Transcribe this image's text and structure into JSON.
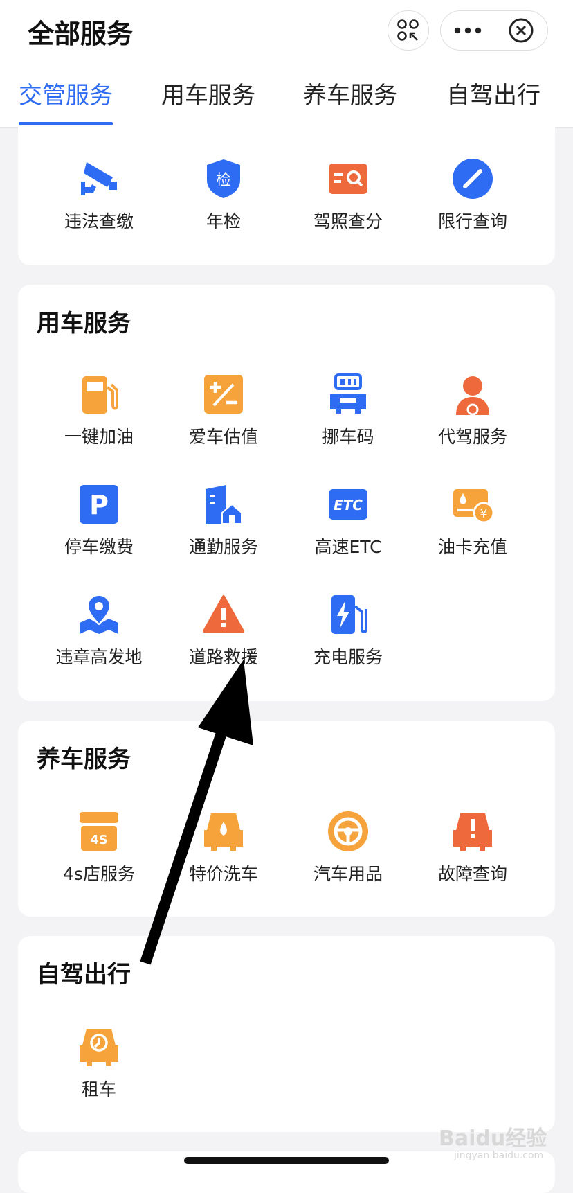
{
  "header": {
    "title": "全部服务",
    "tabs": [
      {
        "label": "交管服务",
        "active": true
      },
      {
        "label": "用车服务",
        "active": false
      },
      {
        "label": "养车服务",
        "active": false
      },
      {
        "label": "自驾出行",
        "active": false
      }
    ]
  },
  "sections": {
    "traffic": {
      "items": [
        {
          "label": "违法查缴",
          "icon": "camera-icon"
        },
        {
          "label": "年检",
          "icon": "inspection-badge-icon"
        },
        {
          "label": "驾照查分",
          "icon": "license-search-icon"
        },
        {
          "label": "限行查询",
          "icon": "no-entry-icon"
        }
      ]
    },
    "car_use": {
      "title": "用车服务",
      "items": [
        {
          "label": "一键加油",
          "icon": "fuel-pump-icon"
        },
        {
          "label": "爱车估值",
          "icon": "plus-minus-icon"
        },
        {
          "label": "挪车码",
          "icon": "car-code-icon"
        },
        {
          "label": "代驾服务",
          "icon": "driver-icon"
        },
        {
          "label": "停车缴费",
          "icon": "parking-icon"
        },
        {
          "label": "通勤服务",
          "icon": "commute-building-icon"
        },
        {
          "label": "高速ETC",
          "icon": "etc-icon"
        },
        {
          "label": "油卡充值",
          "icon": "fuel-card-icon"
        },
        {
          "label": "违章高发地",
          "icon": "map-pin-icon"
        },
        {
          "label": "道路救援",
          "icon": "warning-triangle-icon"
        },
        {
          "label": "充电服务",
          "icon": "ev-charger-icon"
        }
      ]
    },
    "car_care": {
      "title": "养车服务",
      "items": [
        {
          "label": "4s店服务",
          "icon": "4s-shop-icon",
          "badge": "4S"
        },
        {
          "label": "特价洗车",
          "icon": "car-wash-icon"
        },
        {
          "label": "汽车用品",
          "icon": "steering-wheel-icon"
        },
        {
          "label": "故障查询",
          "icon": "car-fault-icon"
        }
      ]
    },
    "self_drive": {
      "title": "自驾出行",
      "items": [
        {
          "label": "租车",
          "icon": "rental-car-icon"
        }
      ]
    }
  },
  "watermark": {
    "main": "Baidu经验",
    "sub": "jingyan.baidu.com"
  },
  "colors": {
    "accent": "#2f6cf4",
    "orange": "#f5a33a",
    "red": "#ee6a3d"
  }
}
